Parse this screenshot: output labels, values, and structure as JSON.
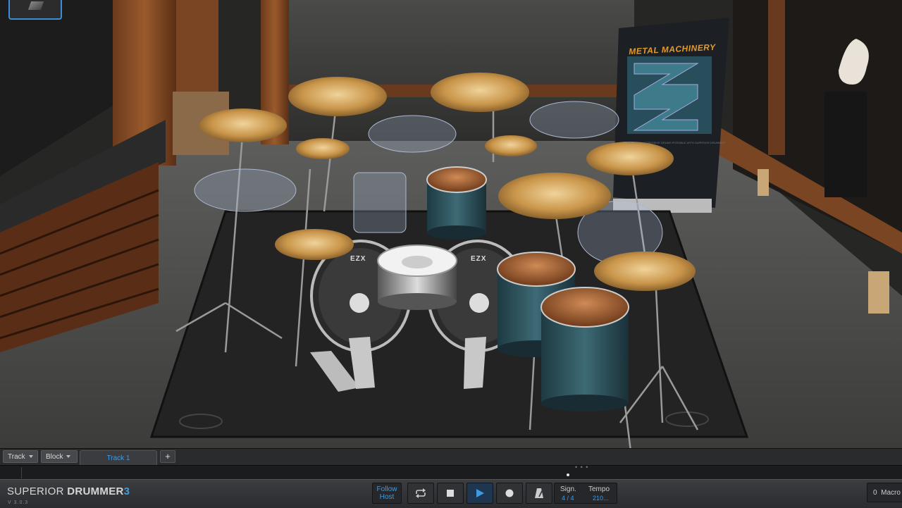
{
  "app": {
    "brand_main": "SUPERIOR",
    "brand_second": "DRUMMER",
    "brand_number": "3",
    "version": "V 3.0.3"
  },
  "scene": {
    "banner_title": "METAL MACHINERY",
    "banner_sub": "THE MOST AGGRESSIVE DRUMS POSSIBLE WITH SUPERIOR DRUMMER",
    "kick_label_left": "EZX",
    "kick_label_right": "EZX"
  },
  "trackbar": {
    "track_menu": "Track",
    "block_menu": "Block",
    "active_tab": "Track 1",
    "add_tab": "+"
  },
  "transport": {
    "follow_line1": "Follow",
    "follow_line2": "Host",
    "sign_label": "Sign.",
    "sign_value": "4 / 4",
    "tempo_label": "Tempo",
    "tempo_value": "210...",
    "macro_count": "0",
    "macro_label": "Macro"
  },
  "colors": {
    "accent": "#3f9be0",
    "banner_orange": "#e39a2c"
  }
}
